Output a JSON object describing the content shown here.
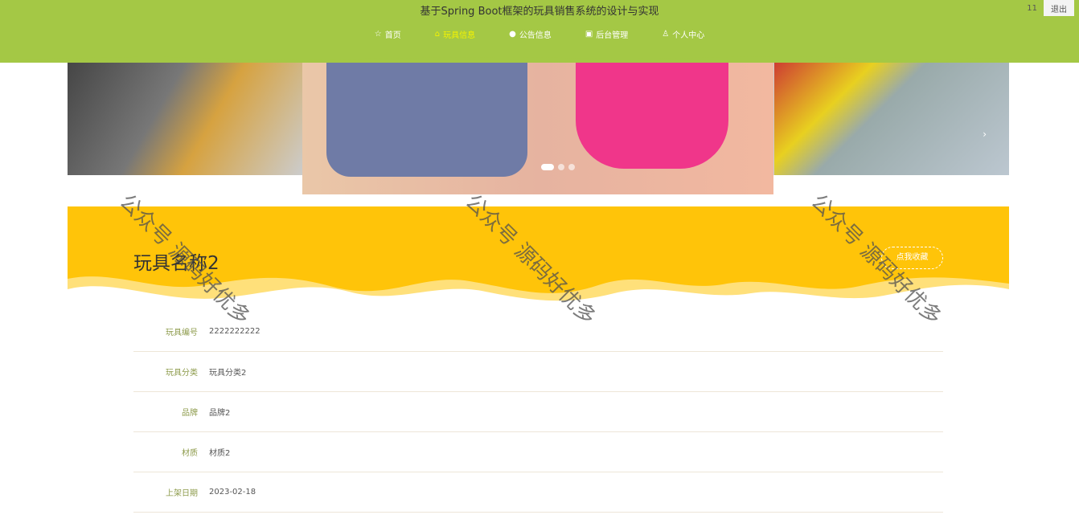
{
  "header": {
    "title": "基于Spring Boot框架的玩具销售系统的设计与实现",
    "username": "11",
    "logout_label": "退出"
  },
  "nav": [
    {
      "label": "首页",
      "icon": "star-icon"
    },
    {
      "label": "玩具信息",
      "icon": "bag-icon",
      "active": true
    },
    {
      "label": "公告信息",
      "icon": "info-icon"
    },
    {
      "label": "后台管理",
      "icon": "briefcase-icon"
    },
    {
      "label": "个人中心",
      "icon": "user-icon"
    }
  ],
  "carousel": {
    "slides": 3,
    "active": 0
  },
  "detail": {
    "title": "玩具名称2",
    "favorite_label": "点我收藏",
    "fields": [
      {
        "label": "玩具编号",
        "value": "2222222222"
      },
      {
        "label": "玩具分类",
        "value": "玩具分类2"
      },
      {
        "label": "品牌",
        "value": "品牌2"
      },
      {
        "label": "材质",
        "value": "材质2"
      },
      {
        "label": "上架日期",
        "value": "2023-02-18"
      }
    ]
  },
  "watermark": "公众号 源码好优多"
}
